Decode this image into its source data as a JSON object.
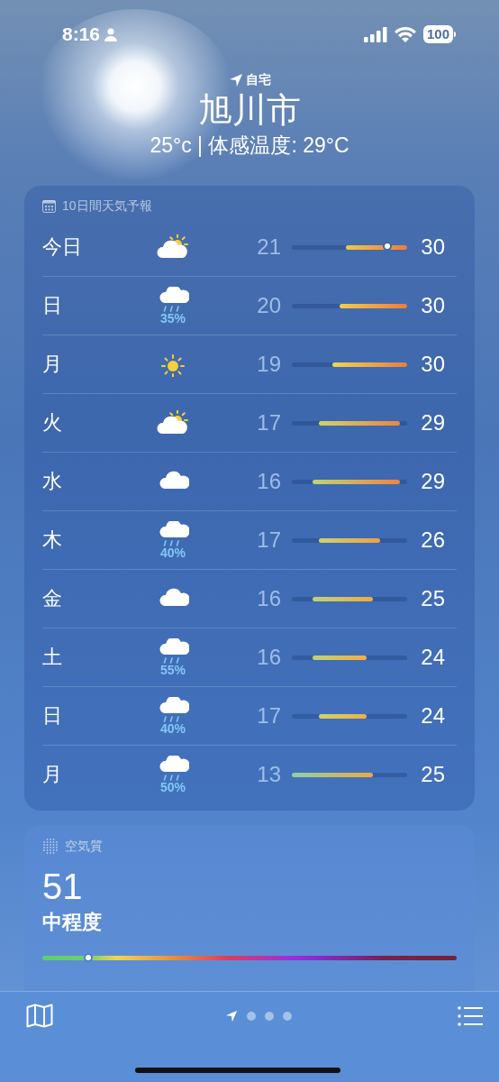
{
  "status_bar": {
    "time": "8:16",
    "battery": "100"
  },
  "location": {
    "label": "自宅",
    "city": "旭川市",
    "conditions": "25°c | 体感温度: 29°C"
  },
  "forecast": {
    "title": "10日間天気予報",
    "days": [
      {
        "day": "今日",
        "kind": "partly_cloudy",
        "low": "21",
        "high": "30",
        "marker": {
          "level": 0.68
        }
      },
      {
        "day": "日",
        "kind": "rain",
        "precip": "35%",
        "low": "20",
        "high": "30"
      },
      {
        "day": "月",
        "kind": "sun",
        "low": "19",
        "high": "30"
      },
      {
        "day": "火",
        "kind": "partly_cloudy",
        "low": "17",
        "high": "29"
      },
      {
        "day": "水",
        "kind": "cloud",
        "low": "16",
        "high": "29"
      },
      {
        "day": "木",
        "kind": "rain",
        "precip": "40%",
        "low": "17",
        "high": "26"
      },
      {
        "day": "金",
        "kind": "cloud",
        "low": "16",
        "high": "25"
      },
      {
        "day": "土",
        "kind": "rain",
        "precip": "55%",
        "low": "16",
        "high": "24"
      },
      {
        "day": "日",
        "kind": "rain",
        "precip": "40%",
        "low": "17",
        "high": "24"
      },
      {
        "day": "月",
        "kind": "rain",
        "precip": "50%",
        "low": "13",
        "high": "25"
      }
    ]
  },
  "air_quality": {
    "title": "空気質",
    "value": "51",
    "category": "中程度",
    "level": 0.11
  },
  "page_dots": [
    {
      "kind": "location",
      "selected": true
    },
    {
      "kind": "dot",
      "selected": false
    },
    {
      "kind": "dot",
      "selected": false
    },
    {
      "kind": "dot",
      "selected": false
    }
  ]
}
